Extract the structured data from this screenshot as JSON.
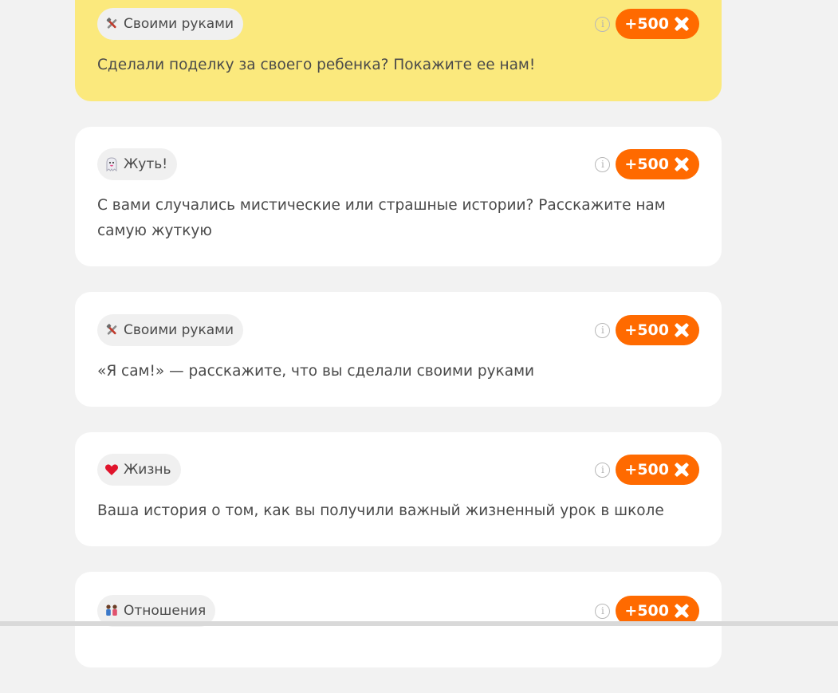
{
  "cards": [
    {
      "tag": {
        "icon": "tools-icon",
        "label": "Своими руками"
      },
      "reward": "+500",
      "text": "Сделали поделку за своего ребенка? Покажите ее нам!",
      "highlighted": true
    },
    {
      "tag": {
        "icon": "ghost-icon",
        "label": "Жуть!"
      },
      "reward": "+500",
      "text": "С вами случались мистические или страшные истории? Расскажите нам самую жуткую",
      "highlighted": false
    },
    {
      "tag": {
        "icon": "tools-icon",
        "label": "Своими руками"
      },
      "reward": "+500",
      "text": "«Я сам!» — расскажите, что вы сделали своими руками",
      "highlighted": false
    },
    {
      "tag": {
        "icon": "heart-icon",
        "label": "Жизнь"
      },
      "reward": "+500",
      "text": "Ваша история о том, как вы получили важный жизненный урок в школе",
      "highlighted": false
    },
    {
      "tag": {
        "icon": "couple-icon",
        "label": "Отношения"
      },
      "reward": "+500",
      "text": "",
      "highlighted": false
    }
  ],
  "colors": {
    "page_background": "#f2f2f2",
    "card_background": "#ffffff",
    "highlight_background": "#fbe97d",
    "reward_orange": "#ff6a00",
    "tag_background": "#f0f0f0",
    "text": "#4a4a4a"
  },
  "icons": {
    "info": "info-icon",
    "reward_symbol": "cross-badge-icon"
  }
}
